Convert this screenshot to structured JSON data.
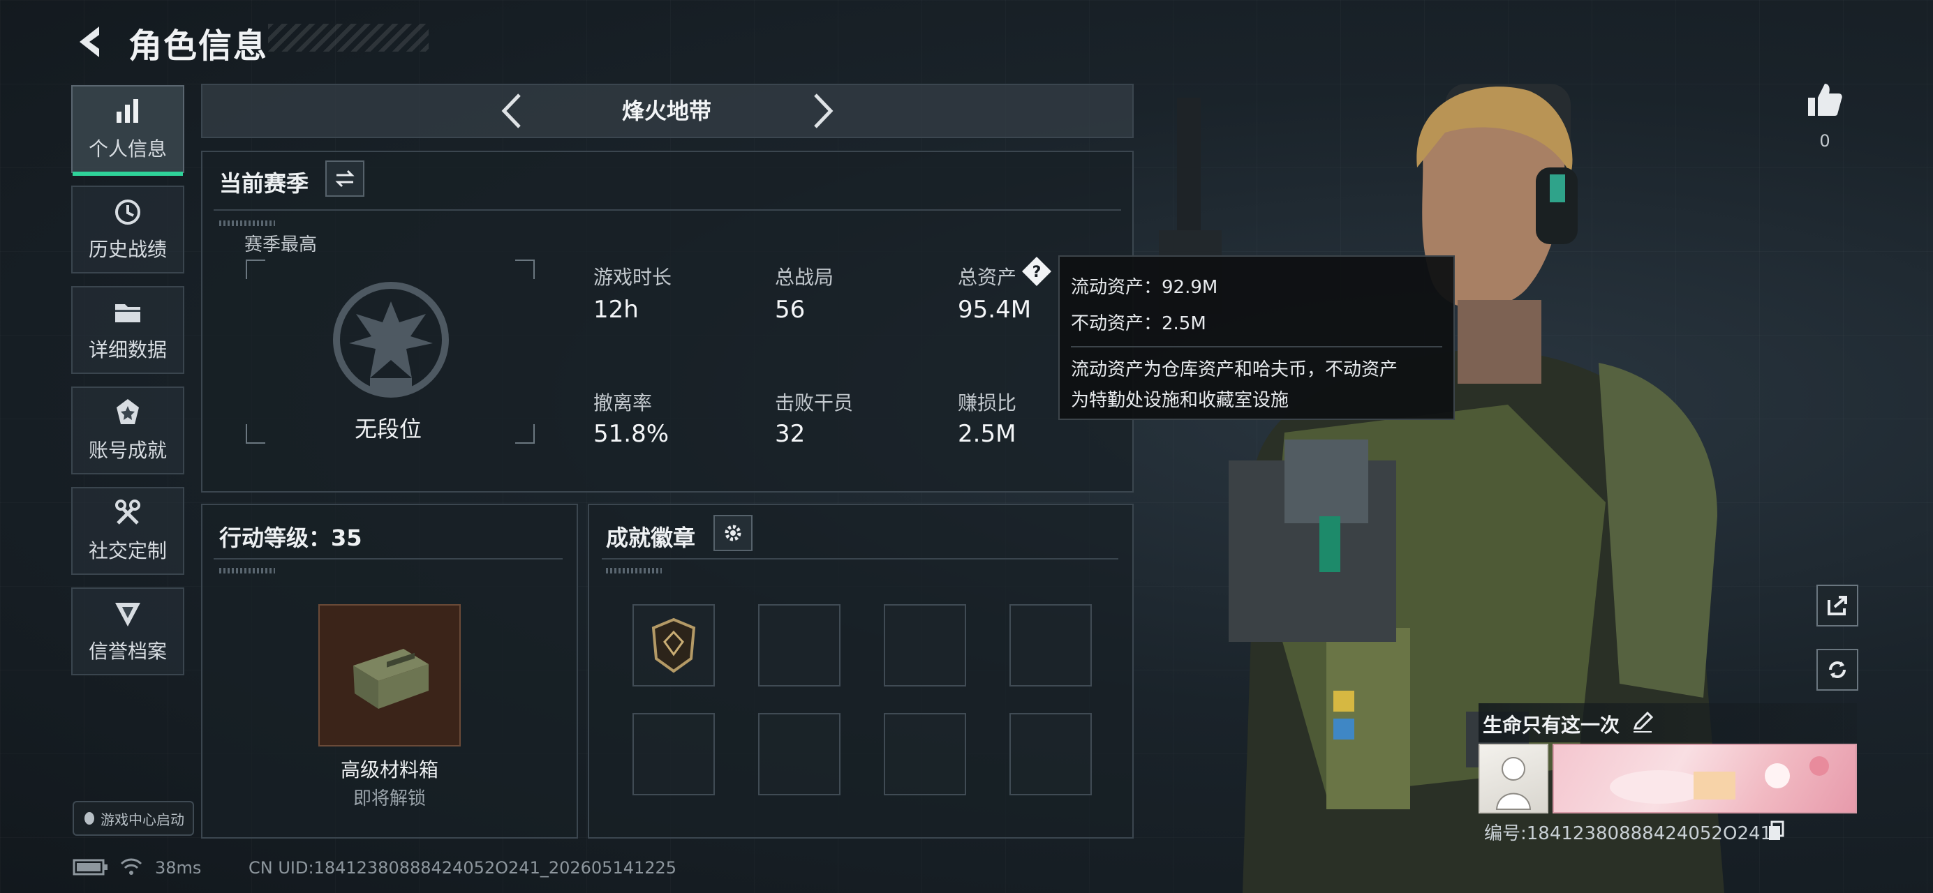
{
  "header": {
    "title": "角色信息"
  },
  "nav": [
    {
      "label": "个人信息",
      "icon": "bar-chart-icon",
      "active": true
    },
    {
      "label": "历史战绩",
      "icon": "history-clock-icon",
      "active": false
    },
    {
      "label": "详细数据",
      "icon": "folder-icon",
      "active": false
    },
    {
      "label": "账号成就",
      "icon": "medal-icon",
      "active": false
    },
    {
      "label": "社交定制",
      "icon": "tools-icon",
      "active": false
    },
    {
      "label": "信誉档案",
      "icon": "shield-emblem-icon",
      "active": false
    }
  ],
  "launch": {
    "label": "游戏中心启动"
  },
  "mode": {
    "title": "烽火地带"
  },
  "season": {
    "title": "当前赛季",
    "best_label": "赛季最高",
    "rank": "无段位"
  },
  "stats": [
    {
      "label": "游戏时长",
      "value": "12h"
    },
    {
      "label": "总战局",
      "value": "56"
    },
    {
      "label": "总资产",
      "value": "95.4M"
    },
    {
      "label": "撤离率",
      "value": "51.8%"
    },
    {
      "label": "击败干员",
      "value": "32"
    },
    {
      "label": "赚损比",
      "value": "2.5M"
    }
  ],
  "tooltip": {
    "line1": "流动资产：92.9M",
    "line2": "不动资产：2.5M",
    "desc1": "流动资产为仓库资产和哈夫币，不动资产",
    "desc2": "为特勤处设施和收藏室设施"
  },
  "level": {
    "title": "行动等级：35",
    "reward_name": "高级材料箱",
    "reward_status": "即将解锁"
  },
  "badges": {
    "title": "成就徽章"
  },
  "likes": {
    "count": "0"
  },
  "card": {
    "title": "生命只有这一次",
    "id": "编号:18412380888424052O241"
  },
  "status": {
    "ping": "38ms",
    "uid": "CN UID:18412380888424052O241_202605141225"
  },
  "colors": {
    "accent": "#2fd39a",
    "panel_border": "#3b464f"
  }
}
